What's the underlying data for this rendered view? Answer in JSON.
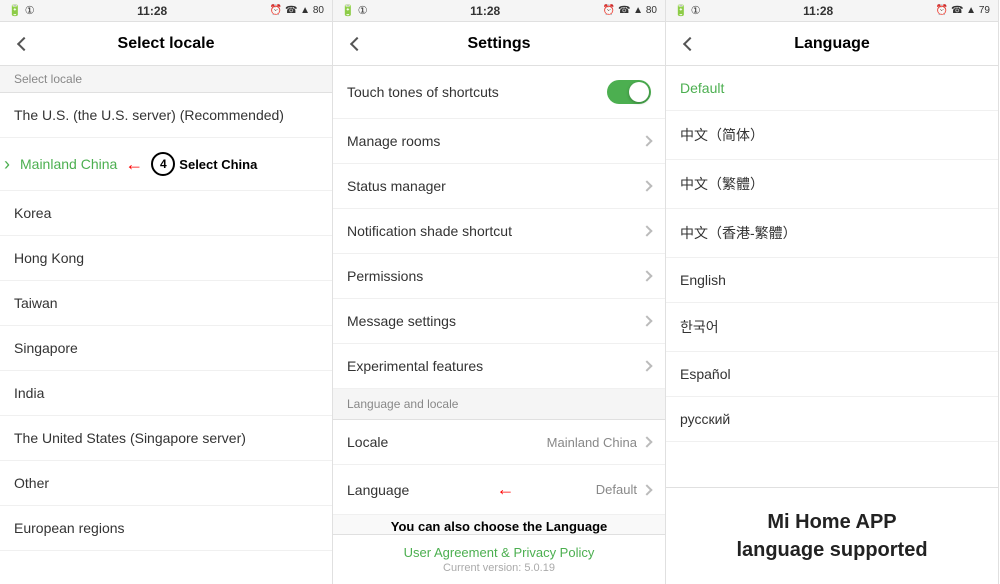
{
  "panel1": {
    "status": {
      "left": "🔋 1",
      "time": "11:28",
      "right": "⏰ 📱 📶 80"
    },
    "header_title": "Select locale",
    "subtitle": "Select locale",
    "items": [
      {
        "id": "us",
        "label": "The U.S. (the U.S. server) (Recommended)",
        "selected": false
      },
      {
        "id": "mainland-china",
        "label": "Mainland China",
        "selected": true
      },
      {
        "id": "korea",
        "label": "Korea",
        "selected": false
      },
      {
        "id": "hong-kong",
        "label": "Hong Kong",
        "selected": false
      },
      {
        "id": "taiwan",
        "label": "Taiwan",
        "selected": false
      },
      {
        "id": "singapore",
        "label": "Singapore",
        "selected": false
      },
      {
        "id": "india",
        "label": "India",
        "selected": false
      },
      {
        "id": "us-singapore",
        "label": "The United States (Singapore server)",
        "selected": false
      },
      {
        "id": "other",
        "label": "Other",
        "selected": false
      },
      {
        "id": "european-regions",
        "label": "European regions",
        "selected": false
      }
    ],
    "step_number": "4",
    "select_china_label": "Select China"
  },
  "panel2": {
    "status": {
      "left": "🔋 1",
      "time": "11:28",
      "right": "⏰ 📱 📶 80"
    },
    "header_title": "Settings",
    "items": [
      {
        "id": "touch-tones",
        "label": "Touch tones of shortcuts",
        "has_toggle": true,
        "toggle_on": true
      },
      {
        "id": "manage-rooms",
        "label": "Manage rooms",
        "has_chevron": true
      },
      {
        "id": "status-manager",
        "label": "Status manager",
        "has_chevron": true
      },
      {
        "id": "notification-shade",
        "label": "Notification shade shortcut",
        "has_chevron": true
      },
      {
        "id": "permissions",
        "label": "Permissions",
        "has_chevron": true
      },
      {
        "id": "message-settings",
        "label": "Message settings",
        "has_chevron": true
      },
      {
        "id": "experimental",
        "label": "Experimental features",
        "has_chevron": true
      }
    ],
    "section_header": "Language and locale",
    "locale_item": {
      "label": "Locale",
      "value": "Mainland China",
      "has_chevron": true
    },
    "language_item": {
      "label": "Language",
      "value": "Default",
      "has_chevron": true
    },
    "language_annotation": "You can also choose the Language",
    "footer_link": "User Agreement & Privacy Policy",
    "footer_version": "Current version: 5.0.19"
  },
  "panel3": {
    "status": {
      "left": "🔋 1",
      "time": "11:28",
      "right": "⏰ 📱 📶 79"
    },
    "header_title": "Language",
    "languages": [
      {
        "id": "default",
        "label": "Default",
        "is_default": true
      },
      {
        "id": "zh-cn",
        "label": "中文（简体）",
        "is_default": false
      },
      {
        "id": "zh-tw",
        "label": "中文（繁體）",
        "is_default": false
      },
      {
        "id": "zh-hk",
        "label": "中文（香港-繁體）",
        "is_default": false
      },
      {
        "id": "english",
        "label": "English",
        "is_default": false
      },
      {
        "id": "korean",
        "label": "한국어",
        "is_default": false
      },
      {
        "id": "spanish",
        "label": "Español",
        "is_default": false
      },
      {
        "id": "russian",
        "label": "русский",
        "is_default": false
      }
    ],
    "mihome_note": "Mi Home APP\nlanguage supported"
  }
}
